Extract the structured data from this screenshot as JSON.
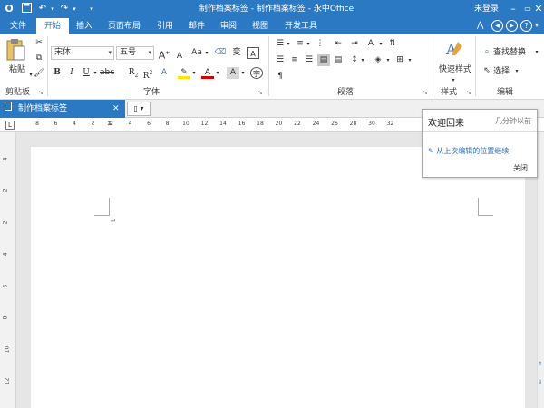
{
  "app": {
    "logo": "O",
    "title": "制作档案标签 - 制作档案标签 - 永中Office",
    "login": "未登录"
  },
  "ribbon_tabs": [
    "文件",
    "开始",
    "插入",
    "页面布局",
    "引用",
    "邮件",
    "审阅",
    "视图",
    "开发工具"
  ],
  "ribbon": {
    "clipboard": {
      "paste_label": "粘贴",
      "group_label": "剪贴板"
    },
    "font": {
      "font_name": "宋体",
      "font_size": "五号",
      "group_label": "字体"
    },
    "paragraph": {
      "group_label": "段落"
    },
    "styles": {
      "quick_style_label": "快速样式",
      "group_label": "样式"
    },
    "editing": {
      "find_replace_label": "查找替换",
      "select_label": "选择",
      "group_label": "编辑"
    }
  },
  "document_tab": {
    "name": "制作档案标签"
  },
  "ruler": {
    "h_ticks": [
      "8",
      "6",
      "4",
      "2",
      "2",
      "4",
      "6",
      "8",
      "10",
      "12",
      "14",
      "16",
      "18",
      "20",
      "22",
      "24",
      "26",
      "28",
      "30",
      "32"
    ],
    "v_ticks": [
      "4",
      "2",
      "2",
      "4",
      "6",
      "8",
      "10",
      "12"
    ]
  },
  "popup": {
    "header": "欢迎回来",
    "time": "几分钟以前",
    "link": "从上次编辑的位置继续",
    "close": "关闭"
  },
  "colors": {
    "accent": "#2b79c2"
  }
}
